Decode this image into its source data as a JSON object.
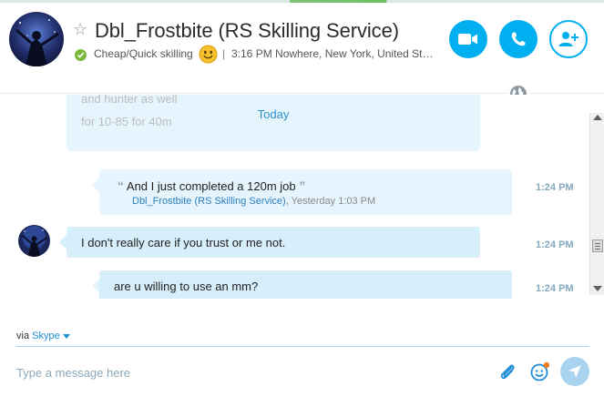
{
  "header": {
    "contact_name": "Dbl_Frostbite (RS Skilling Service)",
    "mood": "Cheap/Quick skilling",
    "separator": "|",
    "local_time_location": "3:16 PM Nowhere, New York, United Sta..."
  },
  "conversation": {
    "faded_lines": [
      "and hunter as well",
      "for 10-85 for 40m"
    ],
    "day_divider": "Today",
    "messages": [
      {
        "quote_text": "And I just completed a 120m job",
        "quote_open": "“",
        "quote_close": "”",
        "quote_author": "Dbl_Frostbite (RS Skilling Service)",
        "quote_time": ", Yesterday 1:03 PM",
        "time": "1:24 PM"
      },
      {
        "text": "I don't really care if you trust or me not.",
        "time": "1:24 PM"
      },
      {
        "text": "are u willing to use an mm?",
        "time": "1:24 PM"
      }
    ]
  },
  "compose": {
    "via_prefix": "via",
    "via_service": "Skype",
    "placeholder": "Type a message here"
  },
  "colors": {
    "accent": "#00aff0",
    "bubble": "#d7eefb",
    "online": "#7bb93c"
  },
  "icons": [
    "star-icon",
    "online-status-icon",
    "smiley-icon",
    "video-call-icon",
    "call-icon",
    "add-people-icon",
    "globe-icon",
    "paperclip-icon",
    "emoticon-icon",
    "send-icon"
  ]
}
